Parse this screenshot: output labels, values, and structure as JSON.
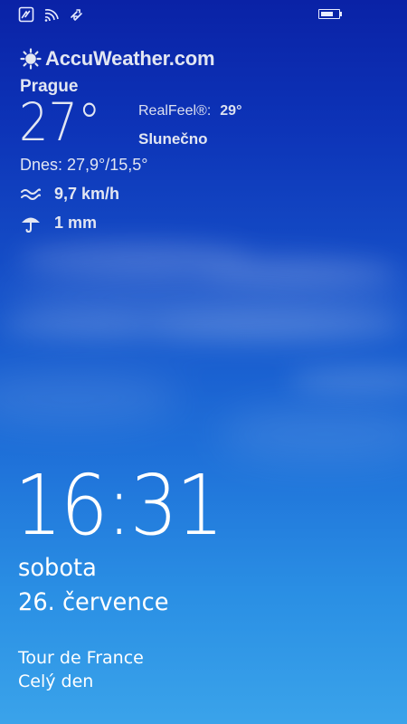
{
  "status_bar": {
    "icons": [
      "notification-icon",
      "wifi-icon",
      "data-sync-icon",
      "battery-icon"
    ],
    "battery_level": 0.75
  },
  "weather": {
    "brand": "AccuWeather.com",
    "brand_icon": "sun-icon",
    "city": "Prague",
    "temperature": "27°",
    "realfeel_label": "RealFeel®:",
    "realfeel_value": "29°",
    "condition": "Slunečno",
    "today": "Dnes: 27,9°/15,5°",
    "wind": "9,7 km/h",
    "wind_icon": "wind-icon",
    "rain": "1 mm",
    "rain_icon": "umbrella-icon"
  },
  "lockscreen": {
    "time": "16:31",
    "day": "sobota",
    "date": "26. července"
  },
  "event": {
    "title": "Tour de France",
    "time": "Celý den"
  },
  "colors": {
    "sky_top": "#0a22a6",
    "sky_bottom": "#3aa3ea",
    "text": "#ffffff"
  }
}
